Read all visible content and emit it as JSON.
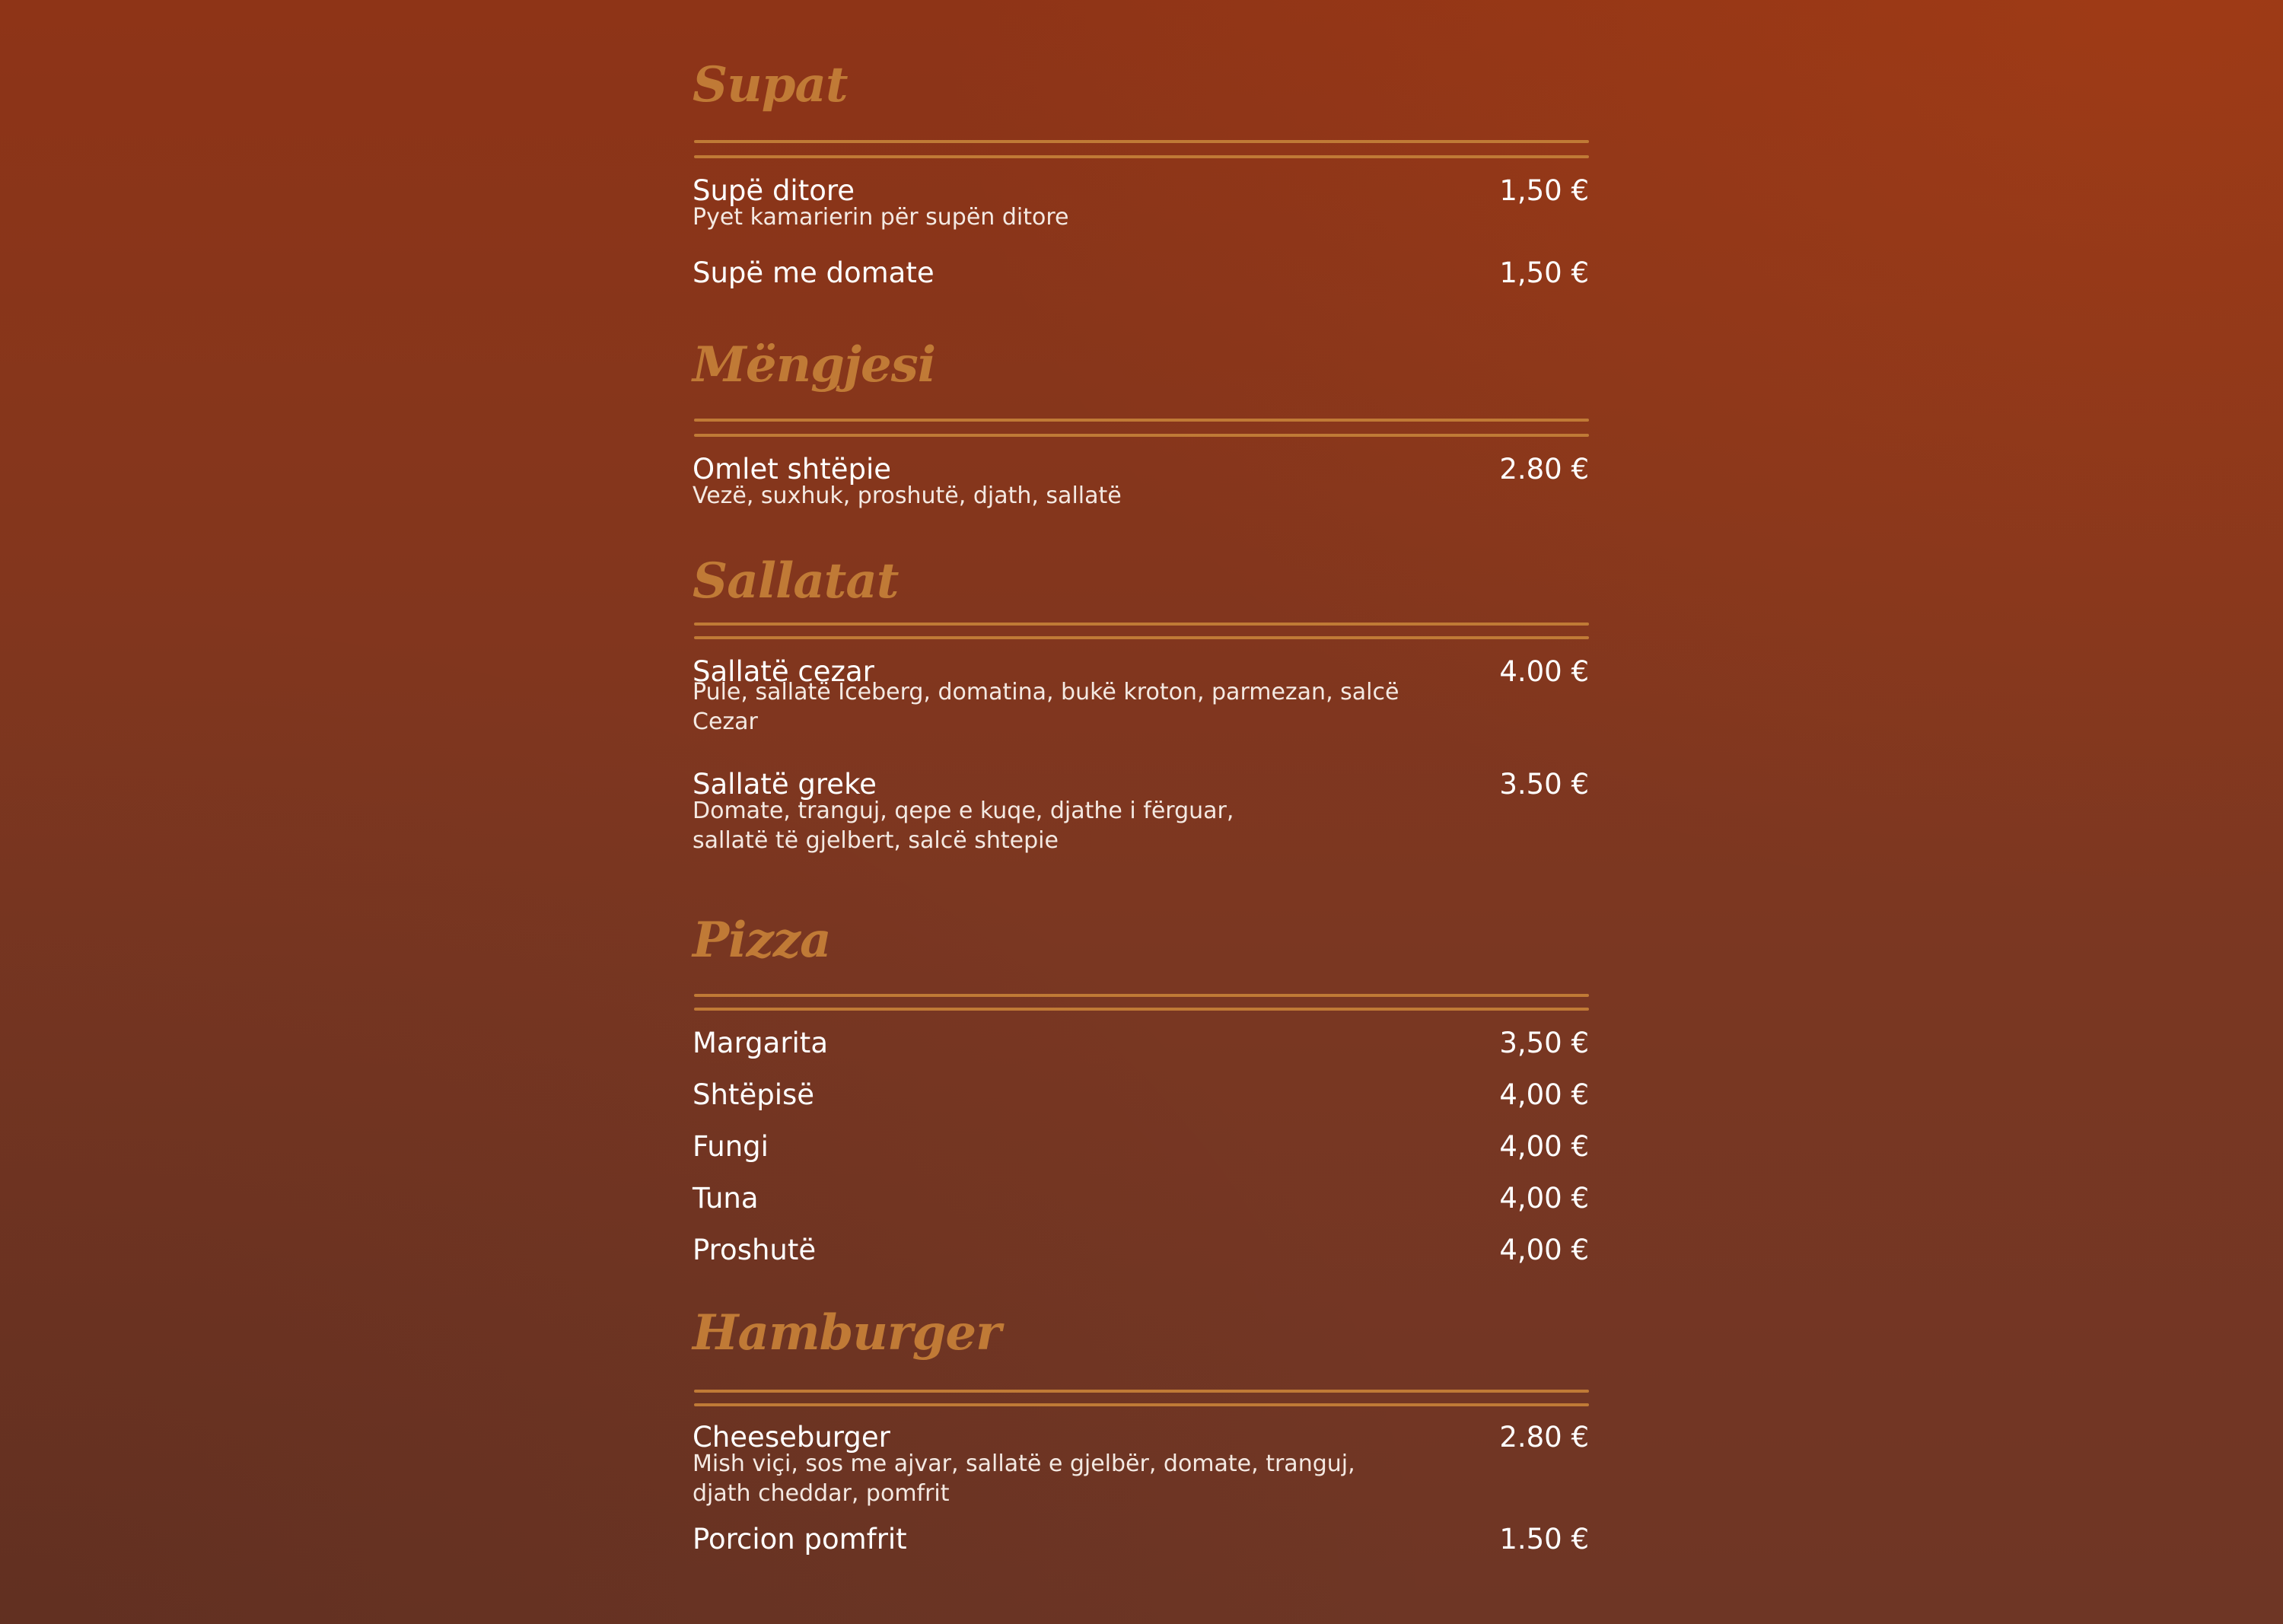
{
  "sections": {
    "supat": {
      "title": "Supat",
      "items": [
        {
          "name": "Supë ditore",
          "description": "Pyet kamarierin për supën ditore",
          "price": "1,50 €"
        },
        {
          "name": "Supë me domate",
          "price": "1,50 €"
        }
      ]
    },
    "mengjesi": {
      "title": "Mëngjesi",
      "items": [
        {
          "name": "Omlet shtëpie",
          "description": "Vezë, suxhuk, proshutë, djath, sallatë",
          "price": "2.80 €"
        }
      ]
    },
    "sallatat": {
      "title": "Sallatat",
      "items": [
        {
          "name": "Sallatë cezar",
          "description": "Pule, sallatë Iceberg, domatina, bukë kroton, parmezan, salcë Cezar",
          "price": "4.00 €"
        },
        {
          "name": "Sallatë greke",
          "description": "Domate, tranguj, qepe e kuqe, djathe i fërguar, sallatë të gjelbert, salcë shtepie",
          "price": "3.50 €"
        }
      ]
    },
    "pizza": {
      "title": "Pizza",
      "items": [
        {
          "name": "Margarita",
          "price": "3,50 €"
        },
        {
          "name": "Shtëpisë",
          "price": "4,00 €"
        },
        {
          "name": "Fungi",
          "price": "4,00 €"
        },
        {
          "name": "Tuna",
          "price": "4,00 €"
        },
        {
          "name": "Proshutë",
          "price": "4,00 €"
        }
      ]
    },
    "hamburger": {
      "title": "Hamburger",
      "items": [
        {
          "name": "Cheeseburger",
          "description": "Mish viçi, sos me ajvar, sallatë e gjelbër, domate, tranguj, djath cheddar, pomfrit",
          "price": "2.80 €"
        },
        {
          "name": "Porcion pomfrit",
          "price": "1.50 €"
        }
      ]
    }
  },
  "colors": {
    "accent": "#c07a36",
    "background_top": "#8e3417",
    "background_bottom": "#6e3625",
    "text": "#ffffff"
  }
}
